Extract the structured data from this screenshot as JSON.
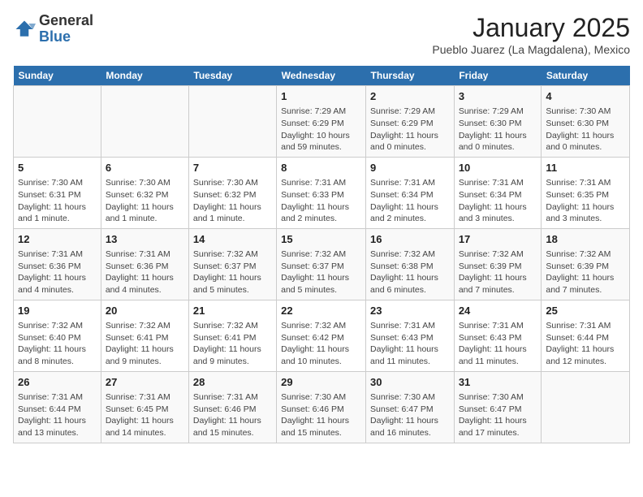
{
  "header": {
    "logo_general": "General",
    "logo_blue": "Blue",
    "title": "January 2025",
    "subtitle": "Pueblo Juarez (La Magdalena), Mexico"
  },
  "days_of_week": [
    "Sunday",
    "Monday",
    "Tuesday",
    "Wednesday",
    "Thursday",
    "Friday",
    "Saturday"
  ],
  "weeks": [
    [
      {
        "day": "",
        "info": ""
      },
      {
        "day": "",
        "info": ""
      },
      {
        "day": "",
        "info": ""
      },
      {
        "day": "1",
        "info": "Sunrise: 7:29 AM\nSunset: 6:29 PM\nDaylight: 10 hours and 59 minutes."
      },
      {
        "day": "2",
        "info": "Sunrise: 7:29 AM\nSunset: 6:29 PM\nDaylight: 11 hours and 0 minutes."
      },
      {
        "day": "3",
        "info": "Sunrise: 7:29 AM\nSunset: 6:30 PM\nDaylight: 11 hours and 0 minutes."
      },
      {
        "day": "4",
        "info": "Sunrise: 7:30 AM\nSunset: 6:30 PM\nDaylight: 11 hours and 0 minutes."
      }
    ],
    [
      {
        "day": "5",
        "info": "Sunrise: 7:30 AM\nSunset: 6:31 PM\nDaylight: 11 hours and 1 minute."
      },
      {
        "day": "6",
        "info": "Sunrise: 7:30 AM\nSunset: 6:32 PM\nDaylight: 11 hours and 1 minute."
      },
      {
        "day": "7",
        "info": "Sunrise: 7:30 AM\nSunset: 6:32 PM\nDaylight: 11 hours and 1 minute."
      },
      {
        "day": "8",
        "info": "Sunrise: 7:31 AM\nSunset: 6:33 PM\nDaylight: 11 hours and 2 minutes."
      },
      {
        "day": "9",
        "info": "Sunrise: 7:31 AM\nSunset: 6:34 PM\nDaylight: 11 hours and 2 minutes."
      },
      {
        "day": "10",
        "info": "Sunrise: 7:31 AM\nSunset: 6:34 PM\nDaylight: 11 hours and 3 minutes."
      },
      {
        "day": "11",
        "info": "Sunrise: 7:31 AM\nSunset: 6:35 PM\nDaylight: 11 hours and 3 minutes."
      }
    ],
    [
      {
        "day": "12",
        "info": "Sunrise: 7:31 AM\nSunset: 6:36 PM\nDaylight: 11 hours and 4 minutes."
      },
      {
        "day": "13",
        "info": "Sunrise: 7:31 AM\nSunset: 6:36 PM\nDaylight: 11 hours and 4 minutes."
      },
      {
        "day": "14",
        "info": "Sunrise: 7:32 AM\nSunset: 6:37 PM\nDaylight: 11 hours and 5 minutes."
      },
      {
        "day": "15",
        "info": "Sunrise: 7:32 AM\nSunset: 6:37 PM\nDaylight: 11 hours and 5 minutes."
      },
      {
        "day": "16",
        "info": "Sunrise: 7:32 AM\nSunset: 6:38 PM\nDaylight: 11 hours and 6 minutes."
      },
      {
        "day": "17",
        "info": "Sunrise: 7:32 AM\nSunset: 6:39 PM\nDaylight: 11 hours and 7 minutes."
      },
      {
        "day": "18",
        "info": "Sunrise: 7:32 AM\nSunset: 6:39 PM\nDaylight: 11 hours and 7 minutes."
      }
    ],
    [
      {
        "day": "19",
        "info": "Sunrise: 7:32 AM\nSunset: 6:40 PM\nDaylight: 11 hours and 8 minutes."
      },
      {
        "day": "20",
        "info": "Sunrise: 7:32 AM\nSunset: 6:41 PM\nDaylight: 11 hours and 9 minutes."
      },
      {
        "day": "21",
        "info": "Sunrise: 7:32 AM\nSunset: 6:41 PM\nDaylight: 11 hours and 9 minutes."
      },
      {
        "day": "22",
        "info": "Sunrise: 7:32 AM\nSunset: 6:42 PM\nDaylight: 11 hours and 10 minutes."
      },
      {
        "day": "23",
        "info": "Sunrise: 7:31 AM\nSunset: 6:43 PM\nDaylight: 11 hours and 11 minutes."
      },
      {
        "day": "24",
        "info": "Sunrise: 7:31 AM\nSunset: 6:43 PM\nDaylight: 11 hours and 11 minutes."
      },
      {
        "day": "25",
        "info": "Sunrise: 7:31 AM\nSunset: 6:44 PM\nDaylight: 11 hours and 12 minutes."
      }
    ],
    [
      {
        "day": "26",
        "info": "Sunrise: 7:31 AM\nSunset: 6:44 PM\nDaylight: 11 hours and 13 minutes."
      },
      {
        "day": "27",
        "info": "Sunrise: 7:31 AM\nSunset: 6:45 PM\nDaylight: 11 hours and 14 minutes."
      },
      {
        "day": "28",
        "info": "Sunrise: 7:31 AM\nSunset: 6:46 PM\nDaylight: 11 hours and 15 minutes."
      },
      {
        "day": "29",
        "info": "Sunrise: 7:30 AM\nSunset: 6:46 PM\nDaylight: 11 hours and 15 minutes."
      },
      {
        "day": "30",
        "info": "Sunrise: 7:30 AM\nSunset: 6:47 PM\nDaylight: 11 hours and 16 minutes."
      },
      {
        "day": "31",
        "info": "Sunrise: 7:30 AM\nSunset: 6:47 PM\nDaylight: 11 hours and 17 minutes."
      },
      {
        "day": "",
        "info": ""
      }
    ]
  ]
}
